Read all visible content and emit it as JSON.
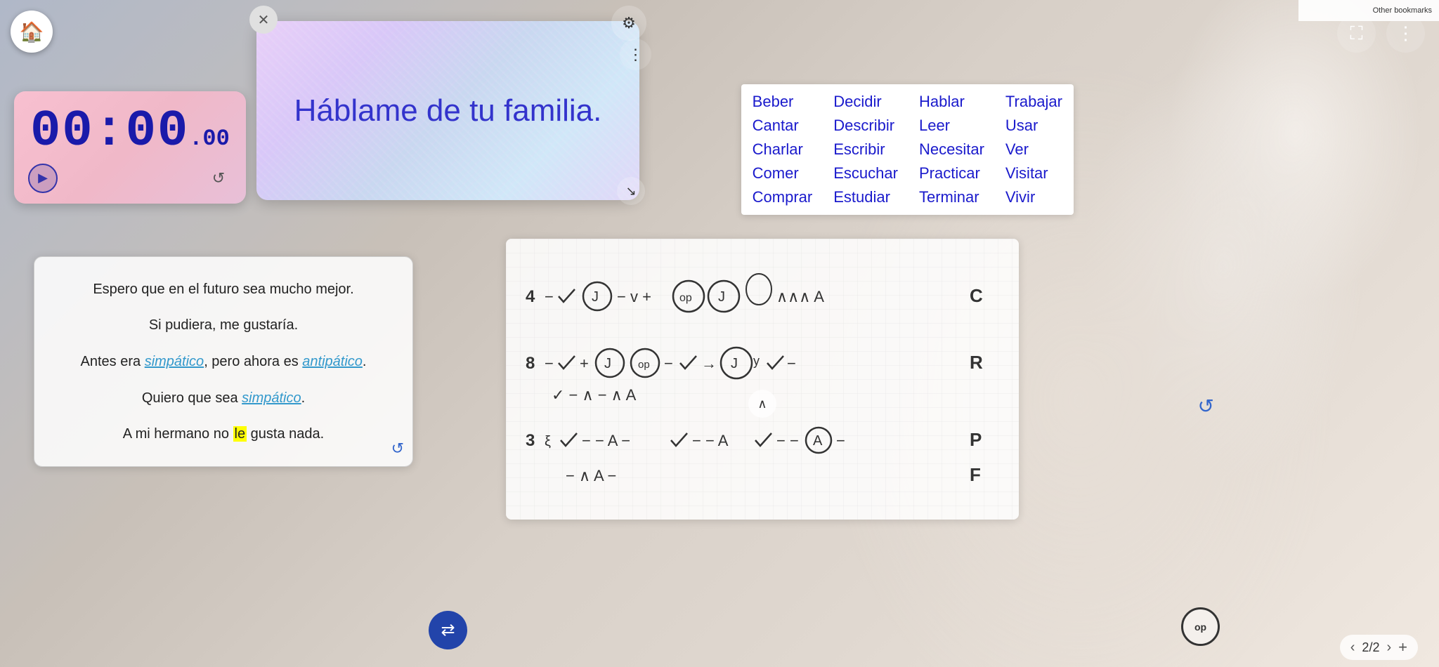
{
  "browser": {
    "bookmarks_label": "Other bookmarks"
  },
  "home_btn": {
    "icon": "🏠"
  },
  "top_right": {
    "fullscreen_icon": "⛶",
    "menu_icon": "⋮"
  },
  "settings": {
    "icon": "⚙"
  },
  "close_btn": {
    "icon": "✕"
  },
  "card_menu": {
    "icon": "⋮"
  },
  "question_card": {
    "text": "Háblame de tu familia."
  },
  "shuffle_btn": {
    "icon": "⇄"
  },
  "expand_btn": {
    "icon": "↘"
  },
  "timer": {
    "main": "00:00",
    "ms": ".00",
    "play_icon": "▶",
    "reset_icon": "↺"
  },
  "verb_panel": {
    "verbs": [
      "Beber",
      "Decidir",
      "Hablar",
      "Trabajar",
      "Cantar",
      "Describir",
      "Leer",
      "Usar",
      "Charlar",
      "Escribir",
      "Necesitar",
      "Ver",
      "Comer",
      "Escuchar",
      "Practicar",
      "Visitar",
      "Comprar",
      "Estudiar",
      "Terminar",
      "Vivir"
    ]
  },
  "text_card": {
    "lines": [
      {
        "text": "Espero que en el futuro sea mucho mejor.",
        "type": "plain"
      },
      {
        "text": "Si pudiera, me gustaría.",
        "type": "plain"
      },
      {
        "text": "Antes era simpático, pero ahora es antipático.",
        "type": "mixed"
      },
      {
        "text": "Quiero que sea simpático.",
        "type": "link"
      },
      {
        "text": "A mi hermano no le gusta nada.",
        "type": "highlight"
      }
    ],
    "refresh_icon": "↺"
  },
  "whiteboard": {
    "scroll_up_icon": "∧",
    "refresh_icon": "↺"
  },
  "pagination": {
    "prev_icon": "‹",
    "next_icon": "›",
    "current": "2",
    "total": "2",
    "add_icon": "+"
  },
  "edge_labels": [
    "C",
    "R",
    "P",
    "F"
  ],
  "op_label": "op"
}
